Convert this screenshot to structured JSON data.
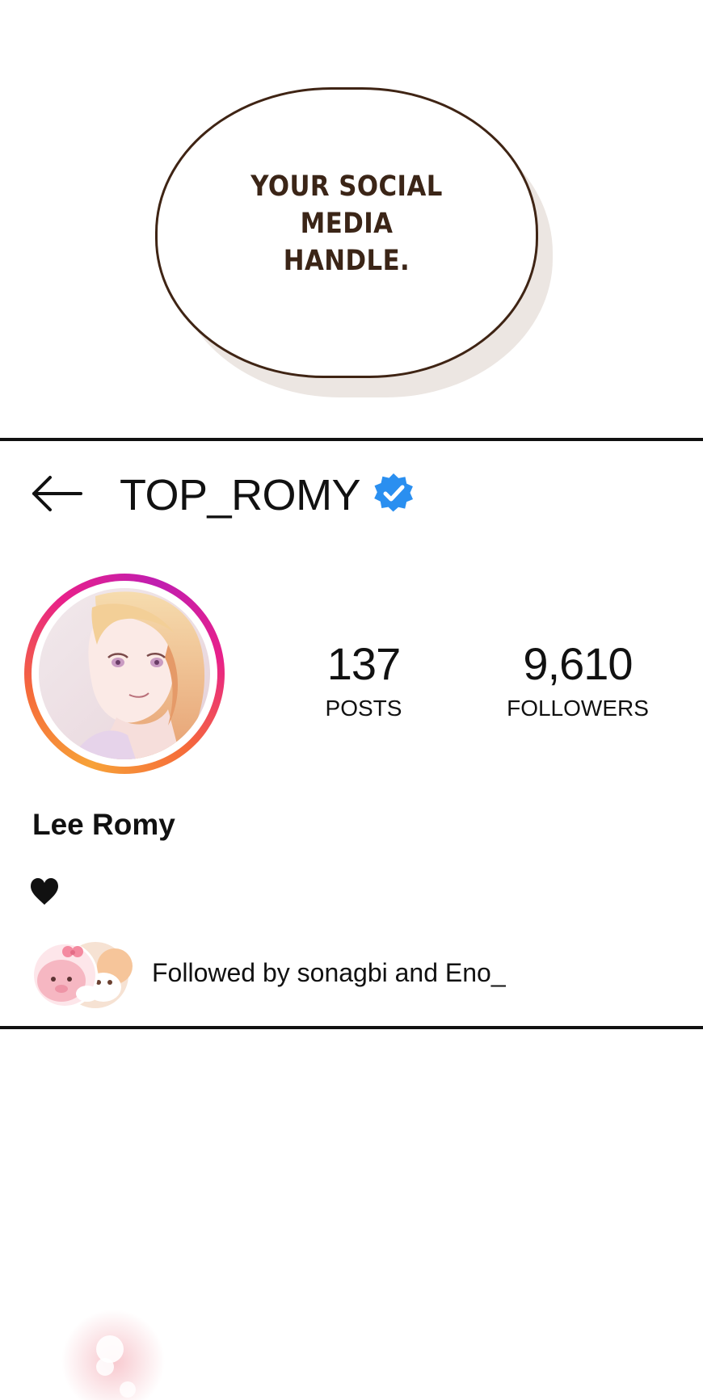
{
  "bubble": {
    "line1": "YOUR SOCIAL MEDIA",
    "line2": "HANDLE."
  },
  "profile": {
    "back_icon": "back-arrow-icon",
    "username": "TOP_ROMY",
    "verified_icon": "verified-badge-icon",
    "verified_color": "#2a8ff0",
    "posts_count": "137",
    "posts_label": "POSTS",
    "followers_count": "9,610",
    "followers_label": "FOLLOWERS",
    "display_name": "Lee Romy",
    "bio_icon": "heart-icon",
    "followed_by": "Followed by sonagbi and Eno_"
  },
  "colors": {
    "ring_start": "#f7a238",
    "ring_end": "#c01eb0",
    "bubble_outline": "#3f2414"
  }
}
